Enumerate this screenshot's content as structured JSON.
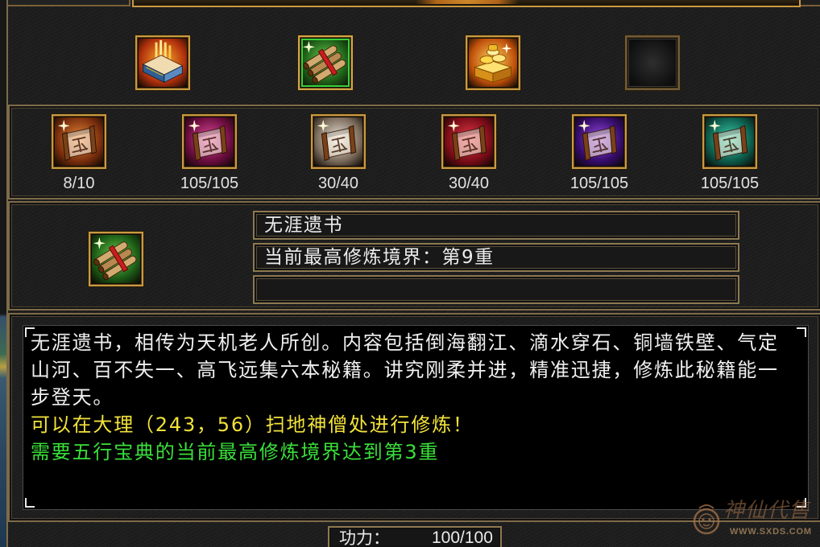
{
  "colors": {
    "frame_gold": "#c89a42",
    "panel_border": "#7e6b49",
    "selected_green": "#3ad03a",
    "text_white": "#f0f0f0",
    "text_yellow": "#f2e23a",
    "text_green": "#3ae03a"
  },
  "book_tabs": [
    {
      "icon": "flame-book-icon",
      "color": "#ffb02a",
      "shade": "#b0300c",
      "selected": false
    },
    {
      "icon": "scroll-bundle-icon",
      "color": "#6ad04a",
      "shade": "#1c5a16",
      "selected": true
    },
    {
      "icon": "gold-treasure-icon",
      "color": "#ffd460",
      "shade": "#c0500a",
      "selected": false
    },
    {
      "icon": "empty-slot-icon",
      "color": "#2e2e2e",
      "shade": "#0e0e0e",
      "selected": false
    }
  ],
  "skill_scrolls": [
    {
      "icon": "scroll-icon",
      "color": "#e8893a",
      "shade": "#7a2e0c",
      "progress": "8/10"
    },
    {
      "icon": "scroll-icon",
      "color": "#e04aa0",
      "shade": "#6a0c3e",
      "progress": "105/105"
    },
    {
      "icon": "scroll-icon",
      "color": "#ece6de",
      "shade": "#7a6a5a",
      "progress": "30/40"
    },
    {
      "icon": "scroll-icon",
      "color": "#e83a4a",
      "shade": "#7a0c18",
      "progress": "30/40"
    },
    {
      "icon": "scroll-icon",
      "color": "#9a4ae0",
      "shade": "#340c6a",
      "progress": "105/105"
    },
    {
      "icon": "scroll-icon",
      "color": "#3ad0b0",
      "shade": "#0c5a4a",
      "progress": "105/105"
    }
  ],
  "selected_book": {
    "icon": "scroll-bundle-icon",
    "color": "#6ad04a",
    "shade": "#1c5a16",
    "name": "无涯遗书",
    "realm": "当前最高修炼境界：第9重",
    "extra": ""
  },
  "description": {
    "lines": [
      "无涯遗书，相传为天机老人所创。内容包括倒海翻江、滴水穿石、铜墙铁壁、气定",
      "山河、百不失一、高飞远集六本秘籍。讲究刚柔并进，精准迅捷，修炼此秘籍能一",
      "步登天。"
    ],
    "location_hint": "可以在大理（243，56）扫地神僧处进行修炼！",
    "requirement": "需要五行宝典的当前最高修炼境界达到第3重"
  },
  "power": {
    "label": "功力：",
    "value": "100/100"
  },
  "watermark": {
    "logo_text": "神仙代售",
    "url": "WWW.SXDS.COM"
  }
}
